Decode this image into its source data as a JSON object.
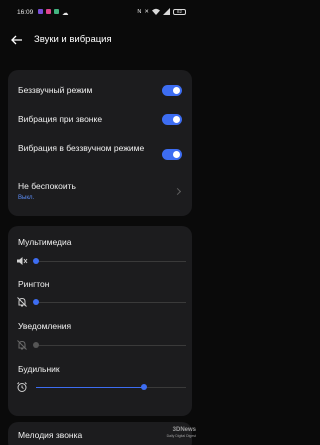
{
  "status_bar": {
    "time": "16:09",
    "battery": "82",
    "notif_colors": [
      "#7a4fd8",
      "#e0448f",
      "#43b581"
    ]
  },
  "header": {
    "back_icon": "arrow-left-icon",
    "title": "Звуки и вибрация"
  },
  "toggles": [
    {
      "label": "Беззвучный режим",
      "on": true
    },
    {
      "label": "Вибрация при звонке",
      "on": true
    },
    {
      "label": "Вибрация в беззвучном режиме",
      "on": true
    }
  ],
  "dnd": {
    "label": "Не беспокоить",
    "value": "Выкл."
  },
  "volumes": [
    {
      "label": "Мультимедиа",
      "icon": "speaker-muted-icon",
      "level": 0.0,
      "enabled": true
    },
    {
      "label": "Рингтон",
      "icon": "bell-muted-icon",
      "level": 0.0,
      "enabled": true
    },
    {
      "label": "Уведомления",
      "icon": "bell-muted-icon",
      "level": 0.0,
      "enabled": false
    },
    {
      "label": "Будильник",
      "icon": "alarm-clock-icon",
      "level": 0.72,
      "enabled": true
    }
  ],
  "ringtone": {
    "label": "Мелодия звонка"
  },
  "watermark": {
    "brand": "3DNews",
    "sub": "Daily Digital Digest"
  },
  "colors": {
    "accent": "#3d6df2",
    "card": "#1c1c1e",
    "background": "#0a0a0a"
  }
}
